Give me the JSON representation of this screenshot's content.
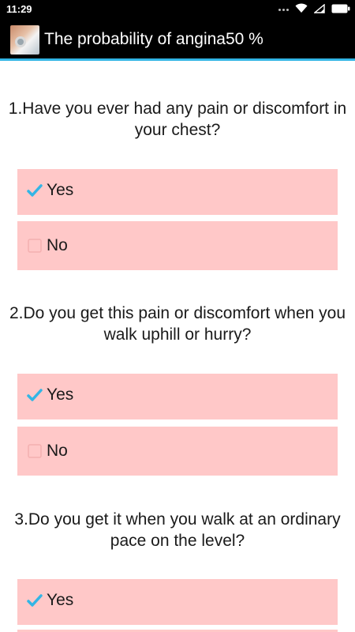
{
  "status_bar": {
    "time": "11:29",
    "icons": [
      "signal-dots-icon",
      "wifi-icon",
      "signal-icon",
      "battery-icon"
    ]
  },
  "app_bar": {
    "title": "The probability of angina50 %",
    "icon": "stethoscope-app-icon",
    "accent_color": "#33b5e5"
  },
  "colors": {
    "option_background": "#ffc8c8",
    "checkmark": "#33b5e5"
  },
  "questions": [
    {
      "text": "1.Have you ever had any pain or discomfort in your chest?",
      "options": [
        {
          "label": "Yes",
          "checked": true
        },
        {
          "label": "No",
          "checked": false
        }
      ]
    },
    {
      "text": "2.Do you get this pain or discomfort when you walk uphill or hurry?",
      "options": [
        {
          "label": "Yes",
          "checked": true
        },
        {
          "label": "No",
          "checked": false
        }
      ]
    },
    {
      "text": "3.Do you get it when you walk at an ordinary pace on the level?",
      "options": [
        {
          "label": "Yes",
          "checked": true
        }
      ]
    }
  ]
}
